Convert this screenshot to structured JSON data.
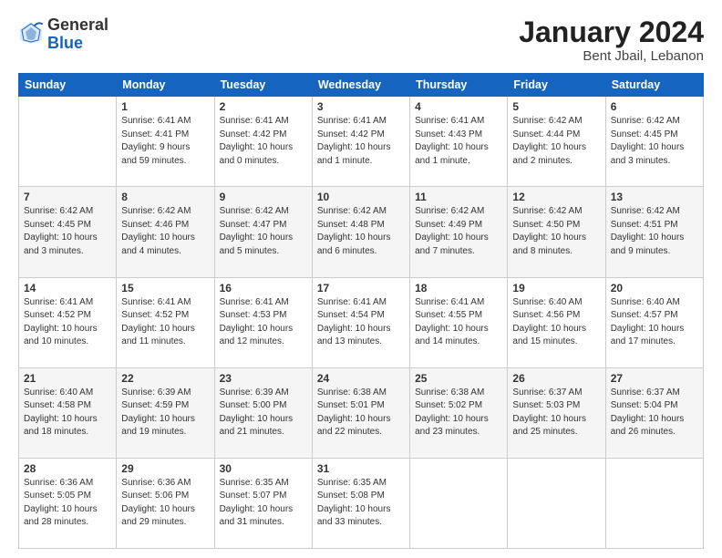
{
  "header": {
    "logo_general": "General",
    "logo_blue": "Blue",
    "month_title": "January 2024",
    "location": "Bent Jbail, Lebanon"
  },
  "weekdays": [
    "Sunday",
    "Monday",
    "Tuesday",
    "Wednesday",
    "Thursday",
    "Friday",
    "Saturday"
  ],
  "weeks": [
    [
      {
        "day": "",
        "info": ""
      },
      {
        "day": "1",
        "info": "Sunrise: 6:41 AM\nSunset: 4:41 PM\nDaylight: 9 hours\nand 59 minutes."
      },
      {
        "day": "2",
        "info": "Sunrise: 6:41 AM\nSunset: 4:42 PM\nDaylight: 10 hours\nand 0 minutes."
      },
      {
        "day": "3",
        "info": "Sunrise: 6:41 AM\nSunset: 4:42 PM\nDaylight: 10 hours\nand 1 minute."
      },
      {
        "day": "4",
        "info": "Sunrise: 6:41 AM\nSunset: 4:43 PM\nDaylight: 10 hours\nand 1 minute."
      },
      {
        "day": "5",
        "info": "Sunrise: 6:42 AM\nSunset: 4:44 PM\nDaylight: 10 hours\nand 2 minutes."
      },
      {
        "day": "6",
        "info": "Sunrise: 6:42 AM\nSunset: 4:45 PM\nDaylight: 10 hours\nand 3 minutes."
      }
    ],
    [
      {
        "day": "7",
        "info": "Sunrise: 6:42 AM\nSunset: 4:45 PM\nDaylight: 10 hours\nand 3 minutes."
      },
      {
        "day": "8",
        "info": "Sunrise: 6:42 AM\nSunset: 4:46 PM\nDaylight: 10 hours\nand 4 minutes."
      },
      {
        "day": "9",
        "info": "Sunrise: 6:42 AM\nSunset: 4:47 PM\nDaylight: 10 hours\nand 5 minutes."
      },
      {
        "day": "10",
        "info": "Sunrise: 6:42 AM\nSunset: 4:48 PM\nDaylight: 10 hours\nand 6 minutes."
      },
      {
        "day": "11",
        "info": "Sunrise: 6:42 AM\nSunset: 4:49 PM\nDaylight: 10 hours\nand 7 minutes."
      },
      {
        "day": "12",
        "info": "Sunrise: 6:42 AM\nSunset: 4:50 PM\nDaylight: 10 hours\nand 8 minutes."
      },
      {
        "day": "13",
        "info": "Sunrise: 6:42 AM\nSunset: 4:51 PM\nDaylight: 10 hours\nand 9 minutes."
      }
    ],
    [
      {
        "day": "14",
        "info": "Sunrise: 6:41 AM\nSunset: 4:52 PM\nDaylight: 10 hours\nand 10 minutes."
      },
      {
        "day": "15",
        "info": "Sunrise: 6:41 AM\nSunset: 4:52 PM\nDaylight: 10 hours\nand 11 minutes."
      },
      {
        "day": "16",
        "info": "Sunrise: 6:41 AM\nSunset: 4:53 PM\nDaylight: 10 hours\nand 12 minutes."
      },
      {
        "day": "17",
        "info": "Sunrise: 6:41 AM\nSunset: 4:54 PM\nDaylight: 10 hours\nand 13 minutes."
      },
      {
        "day": "18",
        "info": "Sunrise: 6:41 AM\nSunset: 4:55 PM\nDaylight: 10 hours\nand 14 minutes."
      },
      {
        "day": "19",
        "info": "Sunrise: 6:40 AM\nSunset: 4:56 PM\nDaylight: 10 hours\nand 15 minutes."
      },
      {
        "day": "20",
        "info": "Sunrise: 6:40 AM\nSunset: 4:57 PM\nDaylight: 10 hours\nand 17 minutes."
      }
    ],
    [
      {
        "day": "21",
        "info": "Sunrise: 6:40 AM\nSunset: 4:58 PM\nDaylight: 10 hours\nand 18 minutes."
      },
      {
        "day": "22",
        "info": "Sunrise: 6:39 AM\nSunset: 4:59 PM\nDaylight: 10 hours\nand 19 minutes."
      },
      {
        "day": "23",
        "info": "Sunrise: 6:39 AM\nSunset: 5:00 PM\nDaylight: 10 hours\nand 21 minutes."
      },
      {
        "day": "24",
        "info": "Sunrise: 6:38 AM\nSunset: 5:01 PM\nDaylight: 10 hours\nand 22 minutes."
      },
      {
        "day": "25",
        "info": "Sunrise: 6:38 AM\nSunset: 5:02 PM\nDaylight: 10 hours\nand 23 minutes."
      },
      {
        "day": "26",
        "info": "Sunrise: 6:37 AM\nSunset: 5:03 PM\nDaylight: 10 hours\nand 25 minutes."
      },
      {
        "day": "27",
        "info": "Sunrise: 6:37 AM\nSunset: 5:04 PM\nDaylight: 10 hours\nand 26 minutes."
      }
    ],
    [
      {
        "day": "28",
        "info": "Sunrise: 6:36 AM\nSunset: 5:05 PM\nDaylight: 10 hours\nand 28 minutes."
      },
      {
        "day": "29",
        "info": "Sunrise: 6:36 AM\nSunset: 5:06 PM\nDaylight: 10 hours\nand 29 minutes."
      },
      {
        "day": "30",
        "info": "Sunrise: 6:35 AM\nSunset: 5:07 PM\nDaylight: 10 hours\nand 31 minutes."
      },
      {
        "day": "31",
        "info": "Sunrise: 6:35 AM\nSunset: 5:08 PM\nDaylight: 10 hours\nand 33 minutes."
      },
      {
        "day": "",
        "info": ""
      },
      {
        "day": "",
        "info": ""
      },
      {
        "day": "",
        "info": ""
      }
    ]
  ]
}
